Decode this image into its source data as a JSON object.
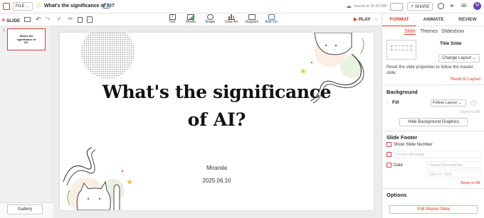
{
  "topbar": {
    "file_label": "FILE",
    "doc_title": "What's the significance of AI?",
    "saved_status": "Saved at 10:42 AM",
    "share_label": "SHARE",
    "avatar_initial": "M"
  },
  "toolbar": {
    "slide_label": "SLIDE",
    "insert_items": [
      {
        "label": "Text",
        "icon": "text-box-icon"
      },
      {
        "label": "Media",
        "icon": "image-icon"
      },
      {
        "label": "Shape",
        "icon": "shape-icon"
      },
      {
        "label": "Data Art",
        "icon": "chart-icon"
      },
      {
        "label": "Diagram",
        "icon": "diagram-icon"
      },
      {
        "label": "Add-On",
        "icon": "puzzle-icon"
      }
    ],
    "play_label": "PLAY"
  },
  "thumbnails": [
    {
      "number": "1",
      "title": "What's the significance of AI?"
    }
  ],
  "gallery_label": "Gallery",
  "slide": {
    "title_line1": "What's the significance",
    "title_line2": "of AI?",
    "author": "Miranda",
    "date": "2025.06.10"
  },
  "panel": {
    "tabs": [
      "FORMAT",
      "ANIMATE",
      "REVIEW"
    ],
    "subtabs": [
      "Slide",
      "Themes",
      "Slideshow"
    ],
    "layout_name": "Title Slide",
    "change_layout": "Change Layout",
    "reset_text": "Reset the slide properties to follow the master slide.",
    "reset_link": "Reset to Layout",
    "background_title": "Background",
    "fill_label": "Fill",
    "fill_value": "Follow Layout",
    "apply_all_1": "Apply to All",
    "hide_bg": "Hide Background Graphics",
    "footer_title": "Slide Footer",
    "show_slide_number": "Show Slide Number",
    "footer_message": "Footer Message",
    "date_label": "Date",
    "date_format": "Update Automatically",
    "date_value": "June 10, 2025",
    "apply_all_2": "Apply to All",
    "options_title": "Options",
    "edit_master": "Edit Master Slide"
  },
  "colors": {
    "accent": "#d43a2a",
    "avatar": "#6a3fb8"
  }
}
